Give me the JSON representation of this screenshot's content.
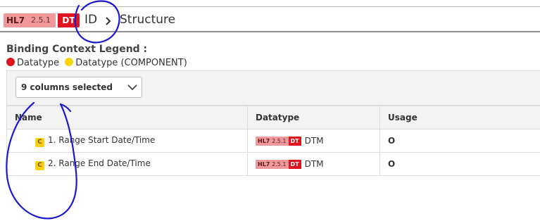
{
  "header": {
    "hl7_label": "HL7",
    "hl7_version": "2.5.1",
    "dt_label": "DT",
    "id_label": "ID",
    "title": "Structure"
  },
  "legend": {
    "title": "Binding Context Legend :",
    "items": [
      {
        "label": "Datatype",
        "color": "#e0141e"
      },
      {
        "label": "Datatype (COMPONENT)",
        "color": "#f7d414"
      }
    ]
  },
  "column_selector": {
    "value": "9 columns selected"
  },
  "table": {
    "headers": [
      "Name",
      "Datatype",
      "Usage"
    ],
    "rows": [
      {
        "badge": "C",
        "name": "1. Range Start Date/Time",
        "hl7": "HL7",
        "version": "2.5.1",
        "dt": "DT",
        "datatype": "DTM",
        "usage": "O"
      },
      {
        "badge": "C",
        "name": "2. Range End Date/Time",
        "hl7": "HL7",
        "version": "2.5.1",
        "dt": "DT",
        "datatype": "DTM",
        "usage": "O"
      }
    ]
  },
  "colors": {
    "hl7_badge": "#f1989b",
    "dt_badge": "#e0141e",
    "component_badge": "#f7cf14",
    "annotation_ink": "#1a1acc"
  }
}
